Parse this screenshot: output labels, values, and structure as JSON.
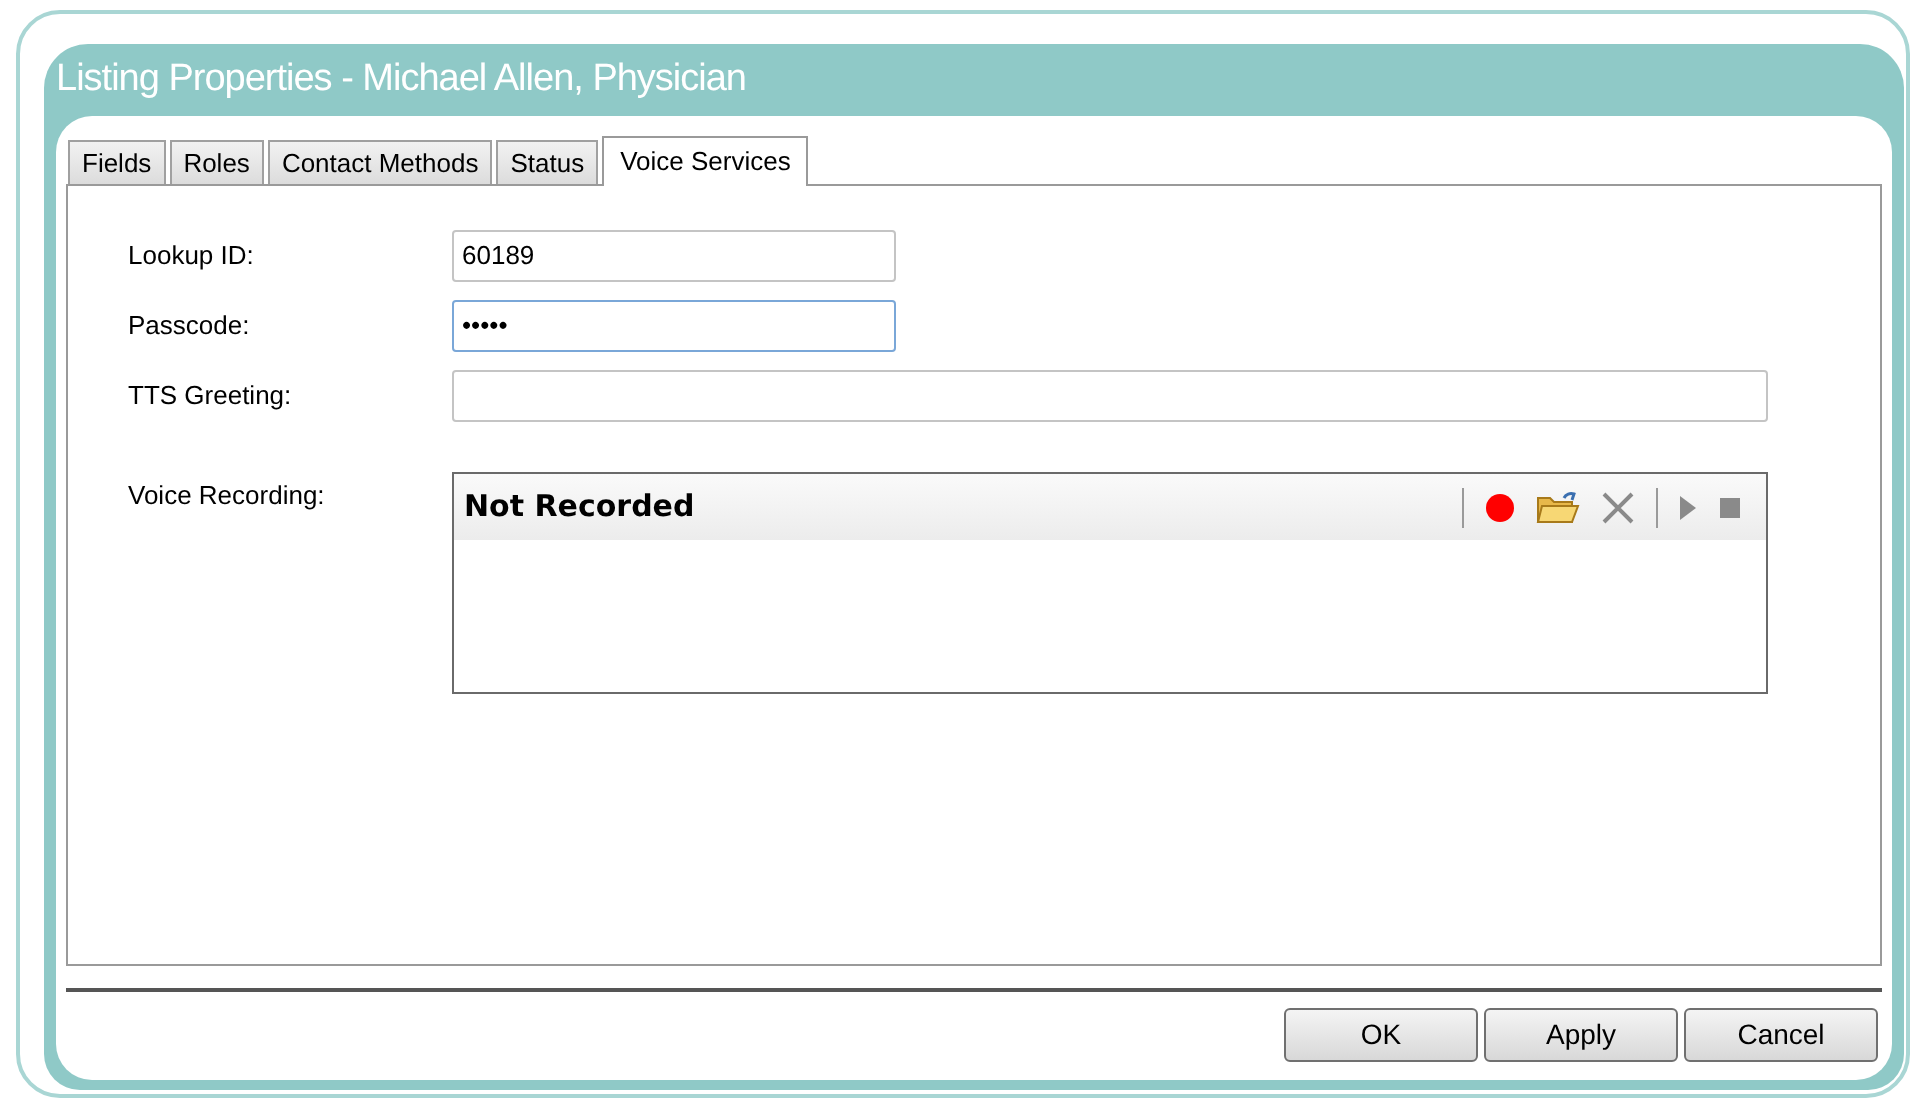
{
  "window": {
    "title": "Listing Properties - Michael Allen, Physician"
  },
  "tabs": [
    {
      "label": "Fields",
      "selected": false
    },
    {
      "label": "Roles",
      "selected": false
    },
    {
      "label": "Contact Methods",
      "selected": false
    },
    {
      "label": "Status",
      "selected": false
    },
    {
      "label": "Voice Services",
      "selected": true
    }
  ],
  "fields": [
    {
      "label": "Lookup ID:",
      "value": "60189",
      "focused": false,
      "wide": false
    },
    {
      "label": "Passcode:",
      "value": "•••••",
      "focused": true,
      "wide": false
    },
    {
      "label": "TTS Greeting:",
      "focused": false,
      "wide": true
    }
  ],
  "voice_recording": {
    "label": "Voice Recording:",
    "status": "Not Recorded",
    "tools": [
      {
        "kind": "record",
        "disabled": false
      },
      {
        "kind": "open",
        "disabled": false
      },
      {
        "kind": "delete",
        "disabled": true
      },
      {
        "kind": "play",
        "disabled": true
      },
      {
        "kind": "stop",
        "disabled": true
      }
    ]
  },
  "buttons": [
    "OK",
    "Apply",
    "Cancel"
  ]
}
